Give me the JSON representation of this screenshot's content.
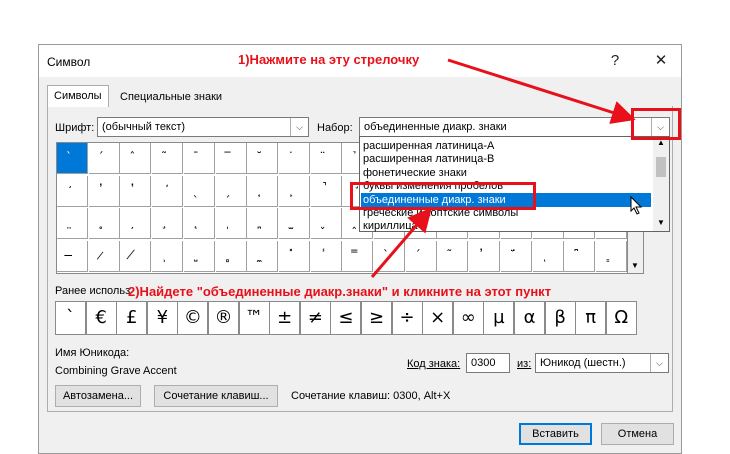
{
  "dialog": {
    "title": "Символ",
    "help_glyph": "?",
    "close_glyph": "✕"
  },
  "tabs": [
    {
      "label": "Символы",
      "active": true
    },
    {
      "label": "Специальные знаки",
      "active": false
    }
  ],
  "font": {
    "label": "Шрифт:",
    "value": "(обычный текст)"
  },
  "subset": {
    "label": "Набор:",
    "value": "объединенные диакр. знаки",
    "options": [
      "расширенная латиница-A",
      "расширенная латиница-B",
      "фонетические знаки",
      "буквы изменения пробелов",
      "объединенные диакр. знаки",
      "греческие и коптские символы",
      "кириллица"
    ],
    "selected_index": 4
  },
  "grid_rows": [
    [
      "̀",
      "́",
      "̂",
      "̃",
      "̄",
      "̅",
      "̆",
      "̇",
      "̈",
      "̉",
      "̊",
      "̋",
      "̌",
      "̍",
      "̎",
      "̏",
      "̐",
      "̑"
    ],
    [
      "̒",
      "̓",
      "̔",
      "̕",
      "̖",
      "̗",
      "̘",
      "̙",
      "̚",
      "̛",
      "̜",
      "̝",
      "̞",
      "̟",
      "̠",
      "̡",
      "̢",
      "̣"
    ],
    [
      "̤",
      "̥",
      "̦",
      "̧",
      "̨",
      "̩",
      "̪",
      "̫",
      "̬",
      "̭",
      "̮",
      "̯",
      "̰",
      "̱",
      "̲",
      "̳",
      "̴",
      "̵"
    ],
    [
      "̶",
      "̷",
      "̸",
      "̹",
      "̺",
      "̻",
      "̼",
      "̽",
      "̾",
      "̿",
      "̀",
      "́",
      "͂",
      "̓",
      "̈́",
      "ͅ",
      "͆",
      "͇"
    ]
  ],
  "recent": {
    "label": "Ранее использ",
    "symbols": [
      "`",
      "€",
      "£",
      "¥",
      "©",
      "®",
      "™",
      "±",
      "≠",
      "≤",
      "≥",
      "÷",
      "×",
      "∞",
      "µ",
      "α",
      "β",
      "π",
      "Ω"
    ]
  },
  "unicode_name": {
    "label": "Имя Юникода:",
    "value": "Combining Grave Accent"
  },
  "char_code": {
    "label": "Код знака:",
    "value": "0300"
  },
  "from": {
    "label": "из:",
    "value": "Юникод (шестн.)"
  },
  "buttons": {
    "autocorrect": "Автозамена...",
    "shortcut_key": "Сочетание клавиш...",
    "insert": "Вставить",
    "cancel": "Отмена"
  },
  "shortcut_info": "Сочетание клавиш: 0300, Alt+X",
  "annotations": {
    "step1": "1)Нажмите на эту стрелочку",
    "step2": "2)Найдете \"объединенные диакр.знаки\" и кликните на этот пункт"
  },
  "colors": {
    "annotation_red": "#e8101a",
    "selection_blue": "#0078d7"
  }
}
